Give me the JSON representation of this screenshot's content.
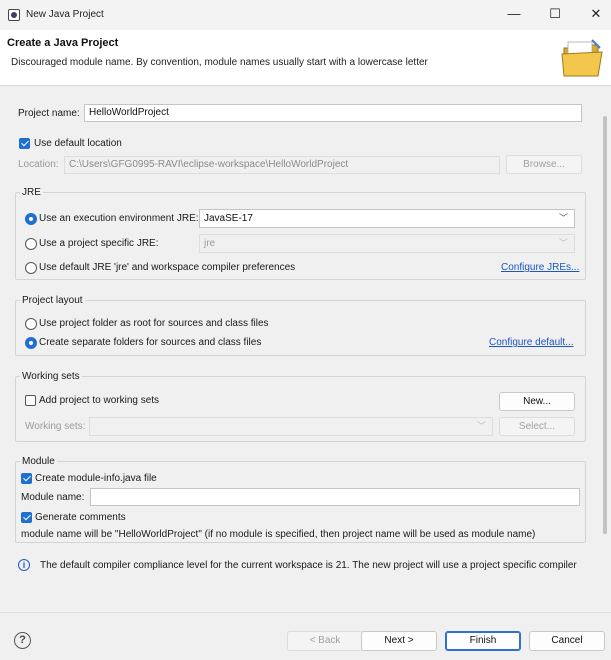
{
  "window": {
    "title": "New Java Project"
  },
  "banner": {
    "heading": "Create a Java Project",
    "message": "Discouraged module name. By convention, module names usually start with a lowercase letter"
  },
  "project": {
    "name_label": "Project name:",
    "name_value": "HelloWorldProject",
    "default_location_label": "Use default location",
    "default_location_checked": true,
    "location_label": "Location:",
    "location_value": "C:\\Users\\GFG0995-RAVI\\eclipse-workspace\\HelloWorldProject",
    "browse_label": "Browse..."
  },
  "jre": {
    "group_title": "JRE",
    "exec_env_label": "Use an execution environment JRE:",
    "exec_env_value": "JavaSE-17",
    "specific_label": "Use a project specific JRE:",
    "specific_value": "jre",
    "default_label": "Use default JRE 'jre' and workspace compiler preferences",
    "configure_link": "Configure JREs..."
  },
  "layout": {
    "group_title": "Project layout",
    "root_label": "Use project folder as root for sources and class files",
    "separate_label": "Create separate folders for sources and class files",
    "configure_link": "Configure default..."
  },
  "working_sets": {
    "group_title": "Working sets",
    "add_label": "Add project to working sets",
    "new_button": "New...",
    "sets_label": "Working sets:",
    "select_button": "Select..."
  },
  "module": {
    "group_title": "Module",
    "create_label": "Create module-info.java file",
    "name_label": "Module name:",
    "name_value": "",
    "comments_label": "Generate comments",
    "note": "module name will be \"HelloWorldProject\"  (if no module is specified, then project name will be used as module name)"
  },
  "info": {
    "text": "The default compiler compliance level for the current workspace is 21. The new project will use a project specific compiler"
  },
  "footer": {
    "back": "< Back",
    "next": "Next >",
    "finish": "Finish",
    "cancel": "Cancel"
  },
  "colors": {
    "accent": "#1f6fd1",
    "link": "#1a56c4"
  }
}
